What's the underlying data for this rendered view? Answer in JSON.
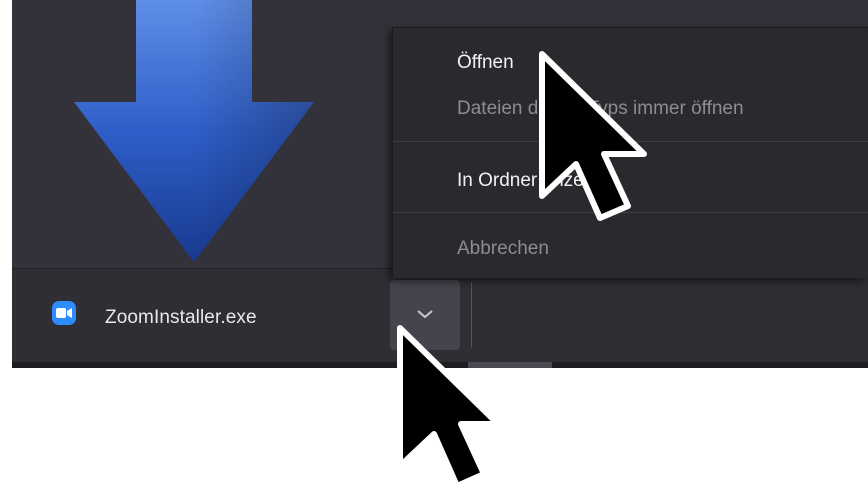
{
  "download_shelf": {
    "file_name": "ZoomInstaller.exe",
    "file_icon": "zoom-video-icon",
    "menu_button_icon": "chevron-down-icon"
  },
  "context_menu": {
    "items": [
      {
        "label": "Öffnen",
        "enabled": true
      },
      {
        "label": "Dateien dieses Typs immer öffnen",
        "enabled": false
      },
      {
        "label": "In Ordner anzeigen",
        "enabled": true
      },
      {
        "label": "Abbrechen",
        "enabled": false
      }
    ]
  },
  "decorations": {
    "download_arrow_icon": "download-arrow-icon",
    "cursor_icon": "mouse-pointer-icon"
  },
  "colors": {
    "zoom_blue": "#2d8cff",
    "arrow_blue": "#2f5ec8",
    "menu_background": "#292a2d",
    "shelf_background": "#2f2e35"
  }
}
